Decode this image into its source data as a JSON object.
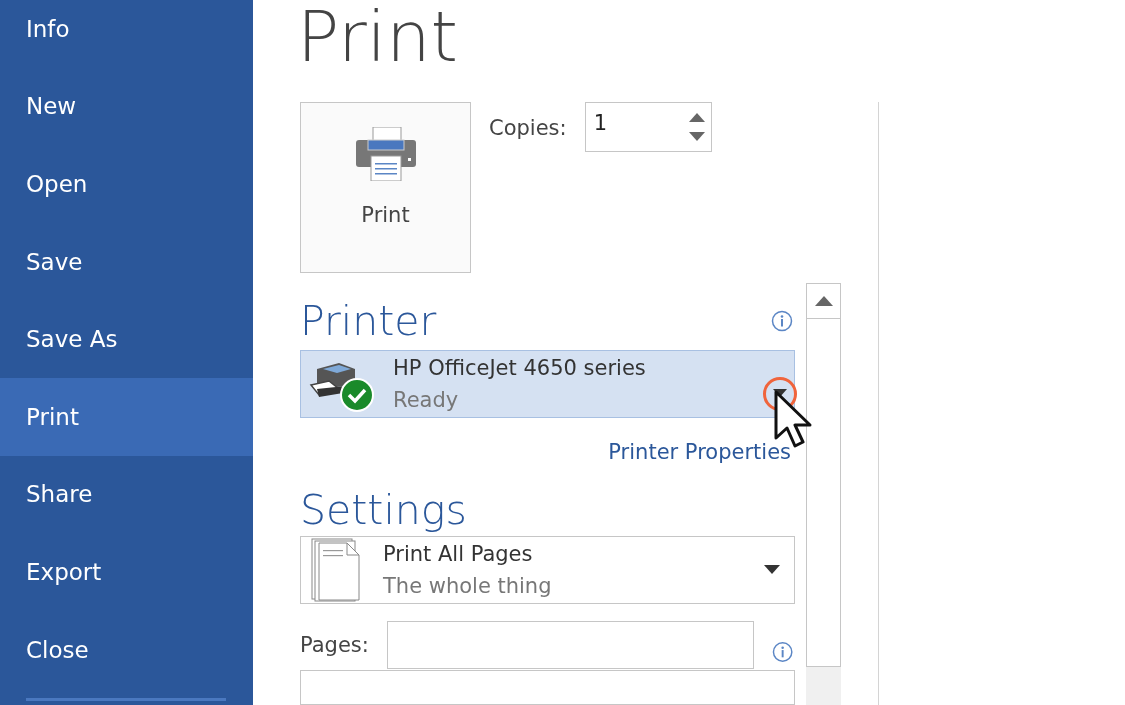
{
  "sidebar": {
    "items": [
      {
        "label": "Info",
        "selected": false
      },
      {
        "label": "New",
        "selected": false
      },
      {
        "label": "Open",
        "selected": false
      },
      {
        "label": "Save",
        "selected": false
      },
      {
        "label": "Save As",
        "selected": false
      },
      {
        "label": "Print",
        "selected": true
      },
      {
        "label": "Share",
        "selected": false
      },
      {
        "label": "Export",
        "selected": false
      },
      {
        "label": "Close",
        "selected": false
      }
    ]
  },
  "title": "Print",
  "print_button": {
    "label": "Print"
  },
  "copies": {
    "label": "Copies:",
    "value": "1"
  },
  "printer": {
    "heading": "Printer",
    "name": "HP OfficeJet 4650 series",
    "status": "Ready",
    "properties_link": "Printer Properties"
  },
  "settings": {
    "heading": "Settings",
    "dropdowns": [
      {
        "title": "Print All Pages",
        "subtitle": "The whole thing"
      }
    ],
    "pages_label": "Pages:"
  }
}
